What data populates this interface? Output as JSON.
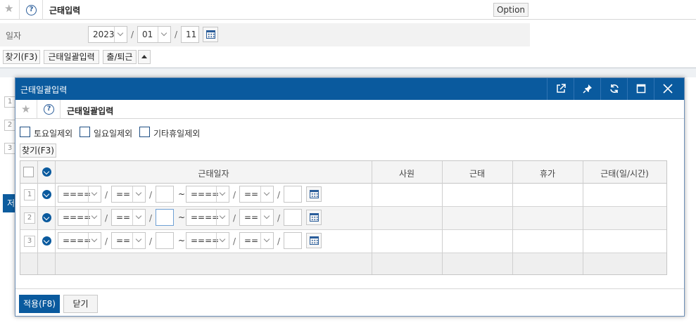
{
  "page": {
    "title": "근태입력",
    "option_label": "Option",
    "date_label": "일자",
    "year": "2023",
    "month": "01",
    "day": "11",
    "date_sep": "/",
    "toolbar": {
      "find_label": "찾기(F3)",
      "bulk_input_label": "근태일괄입력",
      "commute_label": "출/퇴근"
    },
    "grid_row_numbers": [
      "1",
      "2",
      "3"
    ],
    "partial_button_label": "저"
  },
  "modal": {
    "title": "근태일괄입력",
    "subtitle": "근태일괄입력",
    "checkboxes": [
      {
        "label": "토요일제외",
        "checked": false
      },
      {
        "label": "일요일제외",
        "checked": false
      },
      {
        "label": "기타휴일제외",
        "checked": false
      }
    ],
    "find_label": "찾기(F3)",
    "grid": {
      "columns": [
        "근태일자",
        "사원",
        "근태",
        "휴가",
        "근태(일/시간)"
      ],
      "rows": [
        {
          "num": "1",
          "from_year": "====",
          "from_month": "==",
          "from_day": "",
          "to_year": "====",
          "to_month": "==",
          "to_day": "",
          "employee": "",
          "attendance": "",
          "vacation": "",
          "amount": ""
        },
        {
          "num": "2",
          "from_year": "====",
          "from_month": "==",
          "from_day": "",
          "to_year": "====",
          "to_month": "==",
          "to_day": "",
          "employee": "",
          "attendance": "",
          "vacation": "",
          "amount": ""
        },
        {
          "num": "3",
          "from_year": "====",
          "from_month": "==",
          "from_day": "",
          "to_year": "====",
          "to_month": "==",
          "to_day": "",
          "employee": "",
          "attendance": "",
          "vacation": "",
          "amount": ""
        }
      ],
      "range_sep": "~",
      "date_sep": "/"
    },
    "apply_label": "적용(F8)",
    "close_label": "닫기"
  },
  "colors": {
    "primary": "#0a5a9e",
    "header_bg": "#f4f4f4"
  },
  "icons": [
    "star-icon",
    "help-icon",
    "calendar-icon",
    "external-window-icon",
    "pin-icon",
    "refresh-icon",
    "maximize-icon",
    "close-icon",
    "download-circle-icon",
    "chevron-down-icon",
    "triangle-up-icon"
  ]
}
